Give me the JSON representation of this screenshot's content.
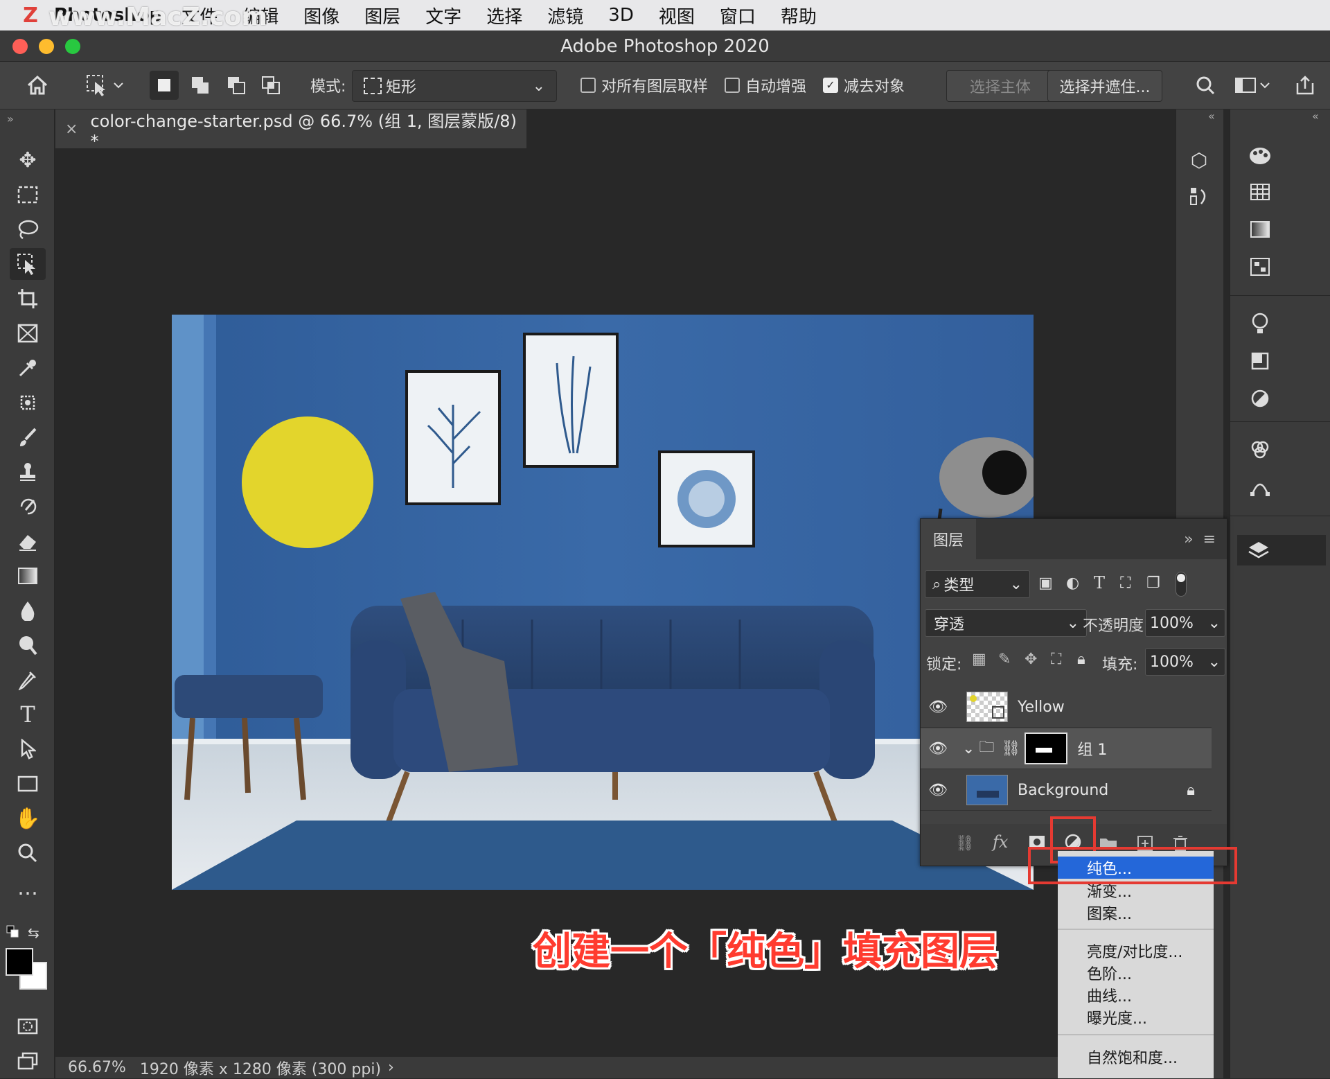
{
  "menubar": {
    "app_name": "Photoshop",
    "items": [
      "文件",
      "编辑",
      "图像",
      "图层",
      "文字",
      "选择",
      "滤镜",
      "3D",
      "视图",
      "窗口",
      "帮助"
    ]
  },
  "watermark": "www.MacZ.com",
  "window": {
    "title": "Adobe Photoshop 2020"
  },
  "options": {
    "mode_label": "模式:",
    "mode_value": "矩形",
    "sample_all": "对所有图层取样",
    "auto_enhance": "自动增强",
    "subtract": "减去对象",
    "select_subject": "选择主体",
    "select_mask": "选择并遮住..."
  },
  "tab": {
    "title": "color-change-starter.psd @ 66.7% (组 1, 图层蒙版/8) *"
  },
  "status": {
    "zoom": "66.67%",
    "info": "1920 像素 x 1280 像素 (300 ppi)"
  },
  "caption": "创建一个「纯色」填充图层",
  "layers_panel": {
    "title": "图层",
    "filter": "类型",
    "blend_mode": "穿透",
    "opacity_label": "不透明度:",
    "opacity": "100%",
    "lock_label": "锁定:",
    "fill_label": "填充:",
    "fill": "100%",
    "layers": [
      {
        "name": "Yellow"
      },
      {
        "name": "组 1"
      },
      {
        "name": "Background"
      }
    ],
    "footer_fx": "fx"
  },
  "adjust_menu": {
    "items": [
      "纯色...",
      "渐变...",
      "图案...",
      "亮度/对比度...",
      "色阶...",
      "曲线...",
      "曝光度...",
      "自然饱和度..."
    ],
    "selected": "纯色..."
  },
  "colors": {
    "wall": "#3a6aa8",
    "sofa": "#2c4a7a",
    "yellow_circle": "#e3d52c",
    "accent_red": "#e53a32",
    "menu_select": "#2467d9"
  }
}
